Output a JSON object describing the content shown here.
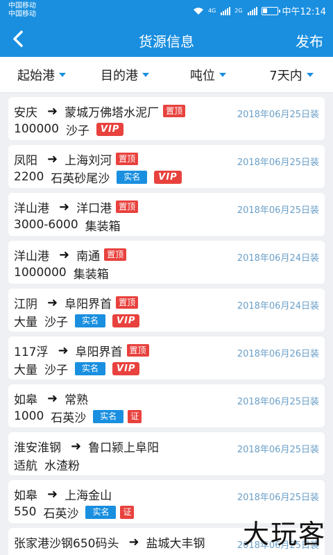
{
  "status": {
    "carrier1": "中国移动",
    "carrier2": "中国移动",
    "net1": "4G",
    "net2": "2G",
    "time": "中午12:14"
  },
  "nav": {
    "title": "货源信息",
    "publish": "发布"
  },
  "filters": [
    "起始港",
    "目的港",
    "吨位",
    "7天内"
  ],
  "arrow": "➜",
  "badges": {
    "top": "置顶",
    "real": "实名",
    "vip": "VIP",
    "cert": "证"
  },
  "items": [
    {
      "from": "安庆",
      "to": "蒙城万佛塔水泥厂",
      "date": "2018年06月25日装",
      "qty": "100000",
      "cargo": "沙子"
    },
    {
      "from": "凤阳",
      "to": "上海刘河",
      "date": "2018年06月25日装",
      "qty": "2200",
      "cargo": "石英砂尾沙"
    },
    {
      "from": "洋山港",
      "to": "洋口港",
      "date": "2018年06月25日装",
      "qty": "3000-6000",
      "cargo": "集装箱"
    },
    {
      "from": "洋山港",
      "to": "南通",
      "date": "2018年06月24日装",
      "qty": "1000000",
      "cargo": "集装箱"
    },
    {
      "from": "江阴",
      "to": "阜阳界首",
      "date": "2018年06月24日装",
      "qty": "大量",
      "cargo": "沙子"
    },
    {
      "from": "117浮",
      "to": "阜阳界首",
      "date": "2018年06月26日装",
      "qty": "大量",
      "cargo": "沙子"
    },
    {
      "from": "如皋",
      "to": "常熟",
      "date": "2018年06月25日装",
      "qty": "1000",
      "cargo": "石英沙"
    },
    {
      "from": "淮安淮钢",
      "to": "鲁口颍上阜阳",
      "date": "2018年06月25日装",
      "qty": "适航",
      "cargo": "水渣粉"
    },
    {
      "from": "如皋",
      "to": "上海金山",
      "date": "2018年06月25日装",
      "qty": "550",
      "cargo": "石英沙"
    },
    {
      "from": "张家港沙钢650码头",
      "to": "盐城大丰钢",
      "date": "2018年06月25日装",
      "qty": "",
      "cargo": ""
    }
  ],
  "watermark": "大玩客"
}
